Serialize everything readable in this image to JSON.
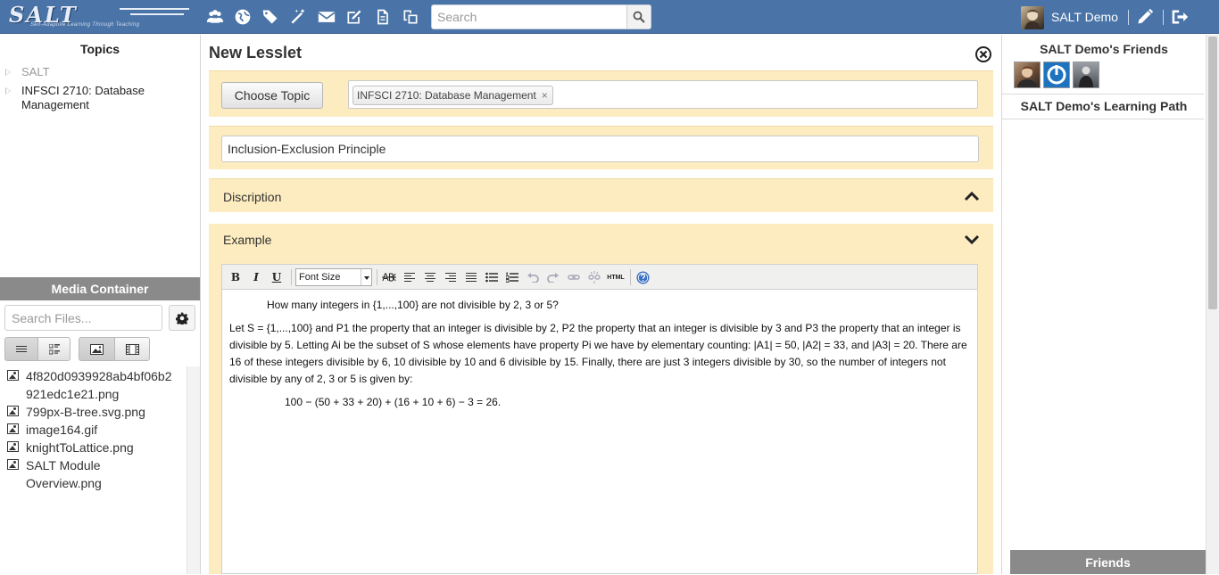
{
  "topbar": {
    "logo_text": "SALT",
    "logo_tagline": "Self-Adaptive Learning Through Teaching",
    "nav_icons": [
      "users-icon",
      "globe-icon",
      "tags-icon",
      "magic-wand-icon",
      "envelope-icon",
      "edit-icon",
      "document-icon",
      "copy-icon"
    ],
    "search_placeholder": "Search",
    "user_name": "SALT Demo",
    "colors": {
      "bar": "#4a74a8",
      "text": "#ffffff"
    }
  },
  "left": {
    "topics_title": "Topics",
    "topics": [
      {
        "label": "SALT"
      },
      {
        "label": "INFSCI 2710: Database Management"
      }
    ],
    "media_title": "Media Container",
    "media_search_placeholder": "Search Files...",
    "files": [
      "4f820d0939928ab4bf06b2921edc1e21.png",
      "799px-B-tree.svg.png",
      "image164.gif",
      "knightToLattice.png",
      "SALT Module Overview.png"
    ]
  },
  "main": {
    "title": "New Lesslet",
    "choose_topic_label": "Choose Topic",
    "selected_topic": "INFSCI 2710: Database Management",
    "topic_remove": "×",
    "lesslet_title_value": "Inclusion-Exclusion Principle",
    "sections": {
      "description": "Discription",
      "example": "Example"
    },
    "editor": {
      "font_size_label": "Font Size",
      "html_label": "HTML",
      "question": "How many integers in {1,...,100} are not divisible by 2, 3 or 5?",
      "solution_line": "Let S = {1,...,100} and P1 the property that an integer is divisible by 2, P2 the property that an integer is divisible by 3 and P3 the property that an integer is divisible by 5. Letting Ai be the subset of S whose elements have property Pi we have by elementary counting: |A1| = 50, |A2| = 33, and |A3| = 20. There are 16 of these integers divisible by 6, 10 divisible by 10 and 6 divisible by 15. Finally, there are just 3 integers divisible by 30, so the number of integers not divisible by any of 2, 3 or 5 is given by:",
      "formula": "100 − (50 + 33 + 20) + (16 + 10 + 6) − 3 = 26."
    },
    "colors": {
      "section_bg": "#fdecc0"
    }
  },
  "right": {
    "friends_title": "SALT Demo's Friends",
    "learning_path_title": "SALT Demo's Learning Path",
    "friends_footer": "Friends"
  }
}
